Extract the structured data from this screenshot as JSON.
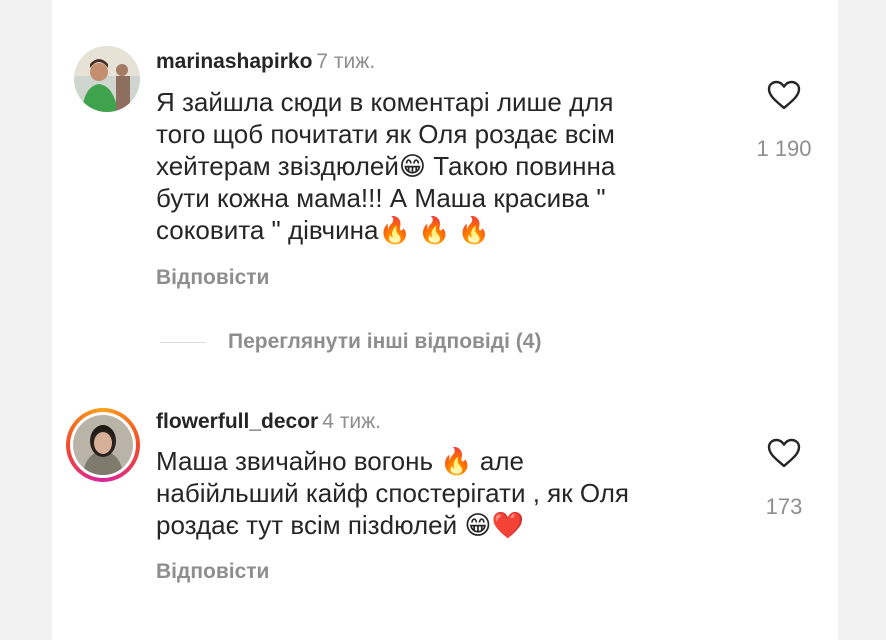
{
  "comments": [
    {
      "username": "marinashapirko",
      "time": "7 тиж.",
      "text_lines": [
        "Я зайшла сюди в коментарі лише для",
        "того щоб почитати як Оля роздає всім",
        "хейтерам звіздюлей😁 Такою повинна",
        "бути кожна мама!!! А Маша красива \"",
        "соковита \" дівчина🔥 🔥 🔥"
      ],
      "reply_label": "Відповісти",
      "like_count": "1 190",
      "avatar_icon": "user-avatar-woman-green-dress"
    },
    {
      "username": "flowerfull_decor",
      "time": "4 тиж.",
      "text_lines": [
        "Маша звичайно вогонь 🔥 але",
        "набійльший кайф спостерігати , як Оля",
        "роздає тут всім пізdюлей 😁❤️"
      ],
      "reply_label": "Відповісти",
      "like_count": "173",
      "avatar_icon": "user-avatar-woman-story-ring"
    }
  ],
  "view_more_replies": "Переглянути інші відповіді (4)",
  "colors": {
    "text": "#262626",
    "muted": "#8e8e8e",
    "divider": "#dbdbdb",
    "background": "#ffffff"
  }
}
